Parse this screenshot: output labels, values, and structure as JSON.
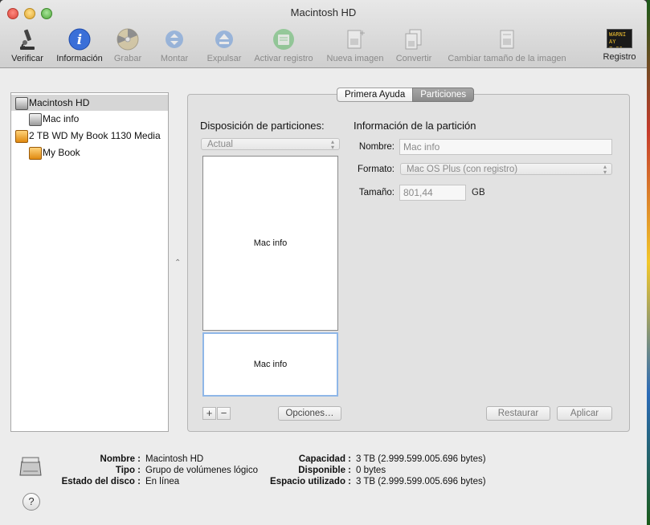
{
  "window": {
    "title": "Macintosh HD"
  },
  "toolbar": {
    "items": [
      {
        "label": "Verificar",
        "icon": "microscope-icon"
      },
      {
        "label": "Información",
        "icon": "info-icon"
      },
      {
        "label": "Grabar",
        "icon": "burn-disc-icon"
      },
      {
        "label": "Montar",
        "icon": "mount-icon"
      },
      {
        "label": "Expulsar",
        "icon": "eject-icon"
      },
      {
        "label": "Activar registro",
        "icon": "journal-icon"
      },
      {
        "label": "Nueva imagen",
        "icon": "new-image-icon"
      },
      {
        "label": "Convertir",
        "icon": "convert-icon"
      },
      {
        "label": "Cambiar tamaño de la imagen",
        "icon": "resize-image-icon"
      },
      {
        "label": "Registro",
        "icon": "log-icon",
        "badge_line1": "WARNI",
        "badge_line2": "AY 7:36"
      }
    ]
  },
  "sidebar": {
    "items": [
      {
        "label": "Macintosh HD",
        "icon": "internal-disk-icon"
      },
      {
        "label": "Mac info",
        "icon": "volume-icon"
      },
      {
        "label": "2 TB WD My Book 1130 Media",
        "icon": "external-disk-icon"
      },
      {
        "label": "My Book",
        "icon": "external-volume-icon"
      }
    ]
  },
  "tabs": [
    {
      "label": "Primera Ayuda"
    },
    {
      "label": "Particiones"
    }
  ],
  "partition": {
    "layout_title": "Disposición de particiones:",
    "layout_value": "Actual",
    "boxes": [
      "Mac info",
      "Mac info"
    ],
    "add": "+",
    "remove": "−",
    "options": "Opciones…",
    "info_title": "Información de la partición",
    "name_label": "Nombre:",
    "name_value": "Mac info",
    "format_label": "Formato:",
    "format_value": "Mac OS Plus (con registro)",
    "size_label": "Tamaño:",
    "size_value": "801,44",
    "size_unit": "GB",
    "revert": "Restaurar",
    "apply": "Aplicar"
  },
  "disk_info": {
    "name_label": "Nombre :",
    "name_value": "Macintosh HD",
    "type_label": "Tipo :",
    "type_value": "Grupo de volúmenes lógico",
    "status_label": "Estado del disco :",
    "status_value": "En línea",
    "capacity_label": "Capacidad :",
    "capacity_value": "3 TB (2.999.599.005.696 bytes)",
    "available_label": "Disponible :",
    "available_value": "0 bytes",
    "used_label": "Espacio utilizado :",
    "used_value": "3 TB (2.999.599.005.696 bytes)"
  },
  "help": "?"
}
